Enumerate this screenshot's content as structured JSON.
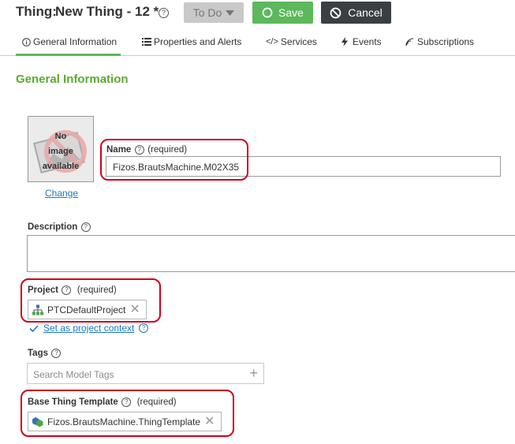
{
  "header": {
    "entity_label": "Thing:",
    "entity_name": "New Thing - 12 *",
    "help_icon": "help-circle-icon",
    "state_button": {
      "label": "To Do",
      "icon": "caret-down-icon"
    },
    "save_button": {
      "label": "Save",
      "icon": "circle-icon",
      "color": "#5cb85c"
    },
    "cancel_button": {
      "label": "Cancel",
      "icon": "ban-icon",
      "color": "#3a3f44"
    }
  },
  "tabs": [
    {
      "label": "General Information",
      "icon": "info-icon",
      "active": true
    },
    {
      "label": "Properties and Alerts",
      "icon": "list-icon"
    },
    {
      "label": "Services",
      "icon": "code-icon"
    },
    {
      "label": "Events",
      "icon": "lightning-icon"
    },
    {
      "label": "Subscriptions",
      "icon": "signal-icon"
    }
  ],
  "section_title": "General Information",
  "image": {
    "placeholder_line1": "No",
    "placeholder_line2": "image",
    "placeholder_line3": "available",
    "change_link": "Change"
  },
  "name": {
    "label": "Name",
    "required": "(required)",
    "value": "Fizos.BrautsMachine.M02X35"
  },
  "description": {
    "label": "Description",
    "value": ""
  },
  "project": {
    "label": "Project",
    "required": "(required)",
    "value": "PTCDefaultProject",
    "set_context_link": "Set as project context"
  },
  "tags": {
    "label": "Tags",
    "placeholder": "Search Model Tags"
  },
  "base_template": {
    "label": "Base Thing Template",
    "required": "(required)",
    "value": "Fizos.BrautsMachine.ThingTemplate"
  },
  "colors": {
    "accent": "#5aab2e",
    "link": "#1a79bf",
    "highlight_ring": "#d0021b"
  }
}
